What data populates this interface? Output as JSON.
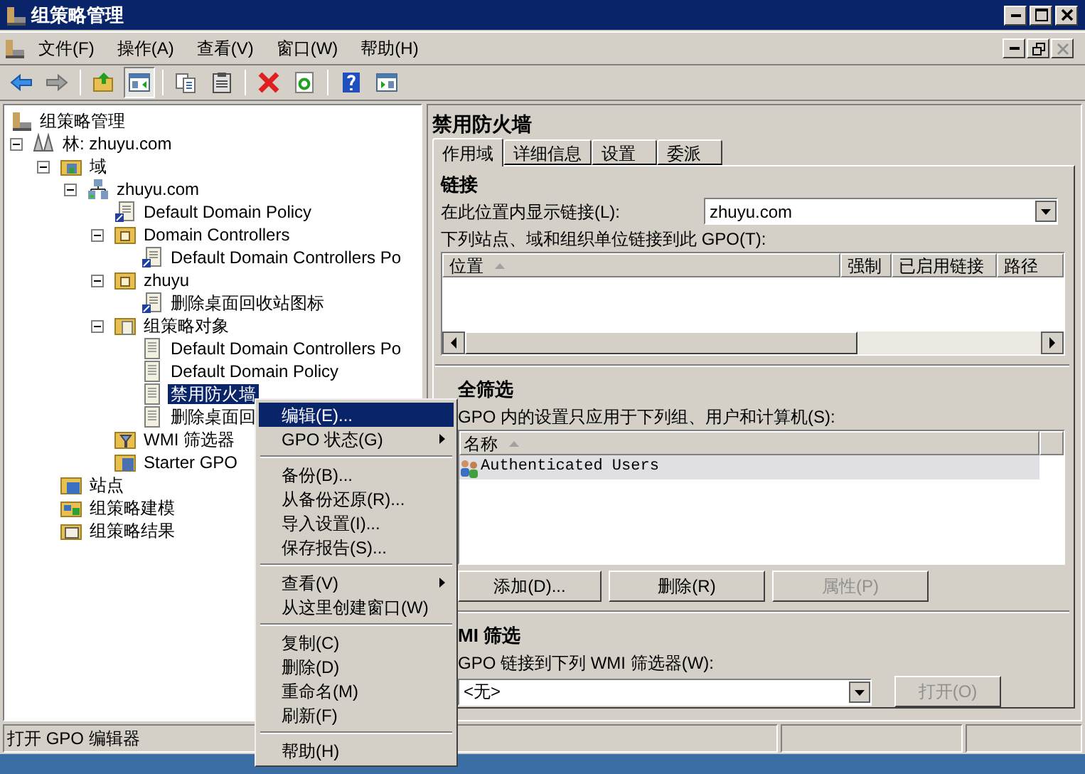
{
  "window": {
    "title": "组策略管理"
  },
  "menu_bar": [
    "文件(F)",
    "操作(A)",
    "查看(V)",
    "窗口(W)",
    "帮助(H)"
  ],
  "tree": [
    {
      "label": "组策略管理",
      "kind": "console",
      "selected": false
    },
    {
      "label": "林: zhuyu.com",
      "kind": "forest",
      "selected": false,
      "expanded": true,
      "children": [
        {
          "label": "域",
          "kind": "domains",
          "selected": false,
          "expanded": true,
          "children": [
            {
              "label": "zhuyu.com",
              "kind": "domain",
              "selected": false,
              "expanded": true,
              "children": [
                {
                  "label": "Default Domain Policy",
                  "kind": "link",
                  "selected": false
                },
                {
                  "label": "Domain Controllers",
                  "kind": "ou",
                  "selected": false,
                  "expanded": true,
                  "children": [
                    {
                      "label": "Default Domain Controllers Po",
                      "kind": "link",
                      "selected": false
                    }
                  ]
                },
                {
                  "label": "zhuyu",
                  "kind": "ou",
                  "selected": false,
                  "expanded": true,
                  "children": [
                    {
                      "label": "删除桌面回收站图标",
                      "kind": "link",
                      "selected": false
                    }
                  ]
                },
                {
                  "label": "组策略对象",
                  "kind": "gpo-folder",
                  "selected": false,
                  "expanded": true,
                  "children": [
                    {
                      "label": "Default Domain Controllers Po",
                      "kind": "gpo",
                      "selected": false
                    },
                    {
                      "label": "Default Domain Policy",
                      "kind": "gpo",
                      "selected": false
                    },
                    {
                      "label": "禁用防火墙",
                      "kind": "gpo",
                      "selected": true
                    },
                    {
                      "label": "删除桌面回",
                      "kind": "gpo",
                      "selected": false
                    }
                  ]
                },
                {
                  "label": "WMI 筛选器",
                  "kind": "wmi",
                  "selected": false
                },
                {
                  "label": "Starter GPO",
                  "kind": "starter",
                  "selected": false
                }
              ]
            }
          ]
        },
        {
          "label": "站点",
          "kind": "sites",
          "selected": false
        },
        {
          "label": "组策略建模",
          "kind": "modeling",
          "selected": false
        },
        {
          "label": "组策略结果",
          "kind": "results",
          "selected": false
        }
      ]
    }
  ],
  "details": {
    "title": "禁用防火墙",
    "tabs": [
      {
        "label": "作用域",
        "selected": true
      },
      {
        "label": "详细信息",
        "selected": false
      },
      {
        "label": "设置",
        "selected": false
      },
      {
        "label": "委派",
        "selected": false
      }
    ],
    "links": {
      "heading": "链接",
      "location_label": "在此位置内显示链接(L):",
      "location_value": "zhuyu.com",
      "list_label": "下列站点、域和组织单位链接到此 GPO(T):",
      "columns": [
        "位置",
        "强制",
        "已启用链接",
        "路径"
      ]
    },
    "security": {
      "heading": "全筛选",
      "label": "GPO 内的设置只应用于下列组、用户和计算机(S):",
      "columns": [
        "名称"
      ],
      "rows": [
        {
          "name": "Authenticated Users",
          "selected": true
        }
      ],
      "buttons": [
        {
          "label": "添加(D)...",
          "disabled": false
        },
        {
          "label": "删除(R)",
          "disabled": false
        },
        {
          "label": "属性(P)",
          "disabled": true
        }
      ]
    },
    "wmi": {
      "heading": "MI 筛选",
      "label": "GPO 链接到下列 WMI 筛选器(W):",
      "value": "<无>",
      "button": {
        "label": "打开(O)",
        "disabled": true
      }
    }
  },
  "context_menu": [
    {
      "kind": "item",
      "label": "编辑(E)...",
      "selected": true,
      "submenu": false
    },
    {
      "kind": "item",
      "label": "GPO 状态(G)",
      "selected": false,
      "submenu": true
    },
    {
      "kind": "separator"
    },
    {
      "kind": "item",
      "label": "备份(B)...",
      "selected": false,
      "submenu": false
    },
    {
      "kind": "item",
      "label": "从备份还原(R)...",
      "selected": false,
      "submenu": false
    },
    {
      "kind": "item",
      "label": "导入设置(I)...",
      "selected": false,
      "submenu": false
    },
    {
      "kind": "item",
      "label": "保存报告(S)...",
      "selected": false,
      "submenu": false
    },
    {
      "kind": "separator"
    },
    {
      "kind": "item",
      "label": "查看(V)",
      "selected": false,
      "submenu": true
    },
    {
      "kind": "item",
      "label": "从这里创建窗口(W)",
      "selected": false,
      "submenu": false
    },
    {
      "kind": "separator"
    },
    {
      "kind": "item",
      "label": "复制(C)",
      "selected": false,
      "submenu": false
    },
    {
      "kind": "item",
      "label": "删除(D)",
      "selected": false,
      "submenu": false
    },
    {
      "kind": "item",
      "label": "重命名(M)",
      "selected": false,
      "submenu": false
    },
    {
      "kind": "item",
      "label": "刷新(F)",
      "selected": false,
      "submenu": false
    },
    {
      "kind": "separator"
    },
    {
      "kind": "item",
      "label": "帮助(H)",
      "selected": false,
      "submenu": false
    }
  ],
  "status_bar": {
    "text": "打开 GPO 编辑器"
  }
}
